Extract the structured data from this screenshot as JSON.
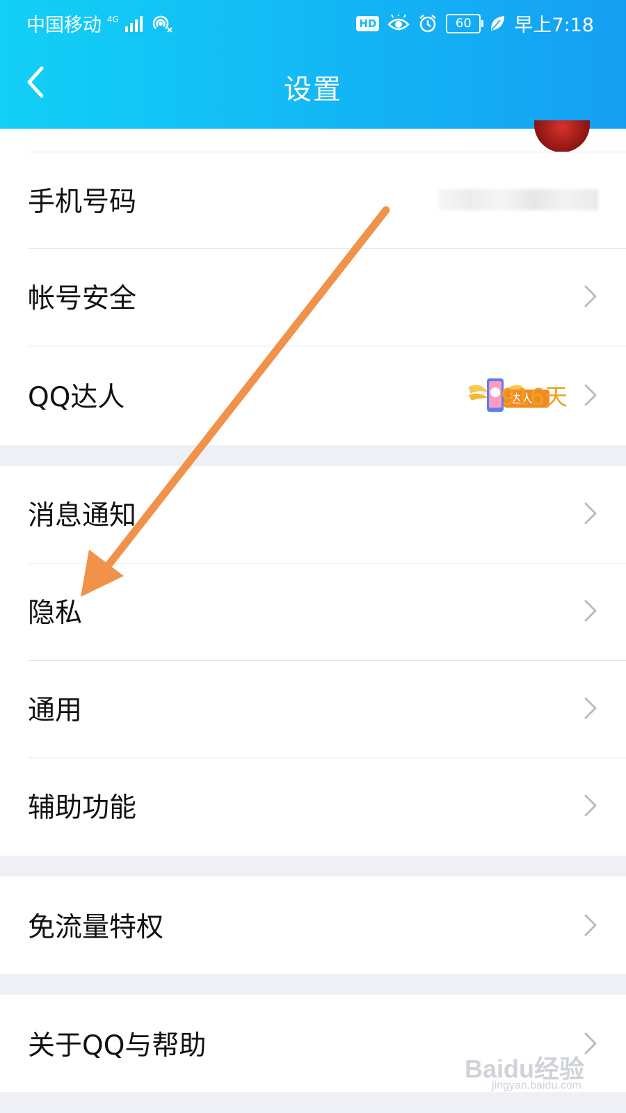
{
  "status_bar": {
    "carrier": "中国移动",
    "network": "4G",
    "hd": "HD",
    "battery": "60",
    "time": "早上7:18"
  },
  "header": {
    "title": "设置"
  },
  "items": [
    {
      "label": "手机号码"
    },
    {
      "label": "帐号安全"
    },
    {
      "label": "QQ达人",
      "badge_text": "达人",
      "days": "916天"
    },
    {
      "label": "消息通知"
    },
    {
      "label": "隐私"
    },
    {
      "label": "通用"
    },
    {
      "label": "辅助功能"
    },
    {
      "label": "免流量特权"
    },
    {
      "label": "关于QQ与帮助"
    }
  ],
  "colors": {
    "header_start": "#12d0f6",
    "header_end": "#159ff2",
    "days_text": "#f0a21c",
    "arrow": "#f0924a"
  },
  "watermark": {
    "text": "Baidu经验",
    "url": "jingyan.baidu.com"
  }
}
